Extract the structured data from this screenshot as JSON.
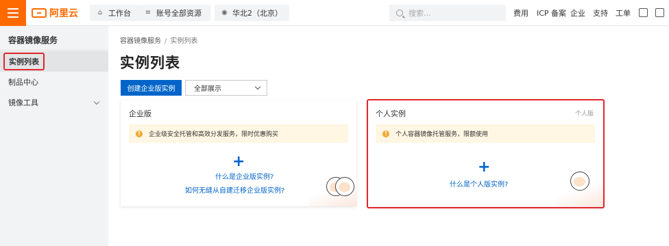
{
  "header": {
    "logo_text": "阿里云",
    "workbench": "工作台",
    "account_scope": "账号全部资源",
    "region": "华北2（北京）",
    "search_placeholder": "搜索...",
    "nav": [
      "费用",
      "ICP 备案",
      "企业",
      "支持",
      "工单"
    ]
  },
  "sidebar": {
    "title": "容器镜像服务",
    "items": [
      {
        "label": "实例列表",
        "active": true
      },
      {
        "label": "制品中心",
        "active": false
      },
      {
        "label": "镜像工具",
        "active": false,
        "expandable": true
      }
    ]
  },
  "main": {
    "breadcrumb": [
      "容器镜像服务",
      "/",
      "实例列表"
    ],
    "title": "实例列表",
    "create_button": "创建企业版实例",
    "filter_select": "全部展示",
    "cards": [
      {
        "title": "企业版",
        "tag": "",
        "notice": "企业级安全托管和高效分发服务，限时优惠购买",
        "links": [
          "什么是企业版实例?",
          "如何无缝从自建迁移企业版实例?"
        ]
      },
      {
        "title": "个人实例",
        "tag": "个人版",
        "notice": "个人容器镜像托管服务，限额使用",
        "links": [
          "什么是个人版实例?"
        ]
      }
    ]
  },
  "colors": {
    "brand_orange": "#ff6a00",
    "primary_blue": "#0064c8",
    "highlight_red": "#e0262b",
    "notice_bg": "#fff6e3"
  },
  "icons": [
    "menu-icon",
    "home-icon",
    "server-icon",
    "location-icon",
    "search-icon",
    "code-icon",
    "terminal-icon",
    "chevron-down-icon",
    "warning-icon",
    "plus-icon",
    "avatar-icon"
  ]
}
